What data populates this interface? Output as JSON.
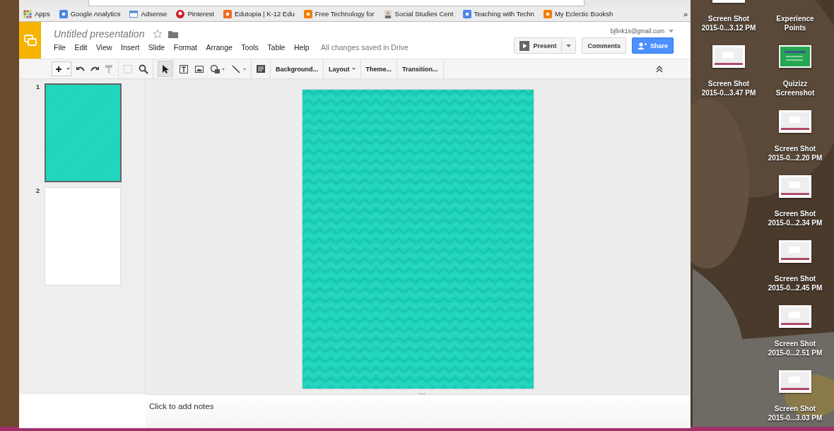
{
  "bookmarks": [
    {
      "label": "Apps",
      "kind": "apps"
    },
    {
      "label": "Google Analytics",
      "kind": "google"
    },
    {
      "label": "Adsense",
      "kind": "window"
    },
    {
      "label": "Pinterest",
      "kind": "pin"
    },
    {
      "label": "Edutopia | K-12 Edu",
      "kind": "edu"
    },
    {
      "label": "Free Technology for",
      "kind": "blogger"
    },
    {
      "label": "Social Studies Cent",
      "kind": "person"
    },
    {
      "label": "Teaching with Techn",
      "kind": "google"
    },
    {
      "label": "My Eclectic Booksh",
      "kind": "blogger"
    }
  ],
  "more_bookmarks": "»",
  "doc": {
    "title": "Untitled presentation",
    "account": "bjfink1s@gmail.com",
    "save_status": "All changes saved in Drive",
    "starred": false
  },
  "menu": [
    "File",
    "Edit",
    "View",
    "Insert",
    "Slide",
    "Format",
    "Arrange",
    "Tools",
    "Table",
    "Help"
  ],
  "buttons": {
    "present": "Present",
    "comments": "Comments",
    "share": "Share"
  },
  "toolbar_buttons": [
    {
      "label": "Background...",
      "dropdown": false
    },
    {
      "label": "Layout",
      "dropdown": true
    },
    {
      "label": "Theme...",
      "dropdown": false
    },
    {
      "label": "Transition...",
      "dropdown": false
    }
  ],
  "slides": [
    {
      "number": "1",
      "selected": true,
      "kind": "pattern"
    },
    {
      "number": "2",
      "selected": false,
      "kind": "blank"
    }
  ],
  "notes_placeholder": "Click to add notes",
  "desktop_columns": [
    [
      {
        "line1": "Screen Shot",
        "line2": "2015-0...3.12 PM",
        "kind": "screenshot"
      },
      {
        "line1": "Screen Shot",
        "line2": "2015-0...3.47 PM",
        "kind": "screenshot"
      }
    ],
    [
      {
        "line1": "Experience",
        "line2": "Points"
      },
      {
        "line1": "Quizizz",
        "line2": "Screenshot",
        "kind": "quiz"
      },
      {
        "line1": "Screen Shot",
        "line2": "2015-0...2.20 PM",
        "kind": "screenshot"
      },
      {
        "line1": "Screen Shot",
        "line2": "2015-0...2.34 PM",
        "kind": "screenshot"
      },
      {
        "line1": "Screen Shot",
        "line2": "2015-0...2.45 PM",
        "kind": "screenshot"
      },
      {
        "line1": "Screen Shot",
        "line2": "2015-0...2.51 PM",
        "kind": "screenshot"
      },
      {
        "line1": "Screen Shot",
        "line2": "2015-0...3.03 PM",
        "kind": "screenshot"
      }
    ]
  ]
}
